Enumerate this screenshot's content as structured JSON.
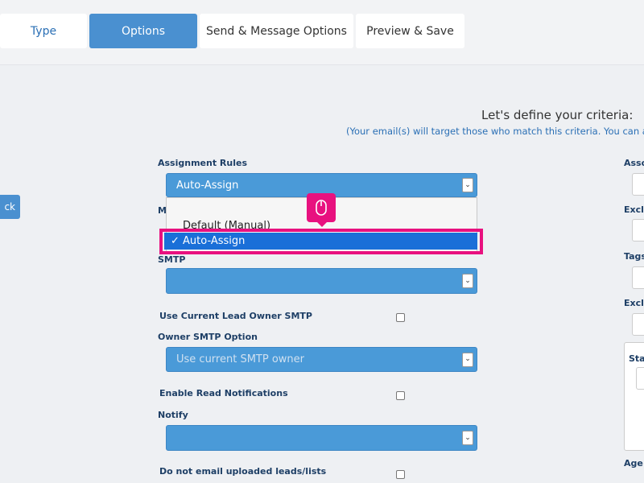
{
  "tabs": [
    {
      "label": "Type",
      "active": false
    },
    {
      "label": "Options",
      "active": true
    },
    {
      "label": "Send & Message Options",
      "active": false
    },
    {
      "label": "Preview & Save",
      "active": false
    }
  ],
  "back_button": {
    "label": "ck"
  },
  "criteria": {
    "heading": "Let's define your criteria:",
    "subheading": "(Your email(s) will target those who match this criteria. You can also"
  },
  "form": {
    "assignment_rules": {
      "label": "Assignment Rules",
      "value": "Auto-Assign"
    },
    "assignment_dropdown": {
      "options": [
        {
          "label": "Default (Manual)"
        },
        {
          "label": "✓ Auto-Assign"
        }
      ]
    },
    "hidden_label_fragment": "M",
    "smtp": {
      "label": "SMTP",
      "value": ""
    },
    "use_current_lead_owner_smtp": {
      "label": "Use Current Lead Owner SMTP",
      "checked": false
    },
    "owner_smtp_option": {
      "label": "Owner SMTP Option",
      "value": "Use current SMTP owner"
    },
    "enable_read_notifications": {
      "label": "Enable Read Notifications",
      "checked": false
    },
    "notify": {
      "label": "Notify",
      "value": ""
    },
    "do_not_email_uploaded": {
      "label": "Do not email uploaded leads/lists",
      "checked": false
    }
  },
  "right_column": {
    "labels": [
      "Asso",
      "Exclu",
      "Tags",
      "Exclu",
      "Stat",
      "Age"
    ]
  },
  "icons": {
    "chevron": "chevron-down-icon",
    "cursor": "mouse-icon"
  },
  "colors": {
    "accent": "#4a90d0",
    "highlight": "#e8117f",
    "selected_option": "#1a6fd8"
  }
}
